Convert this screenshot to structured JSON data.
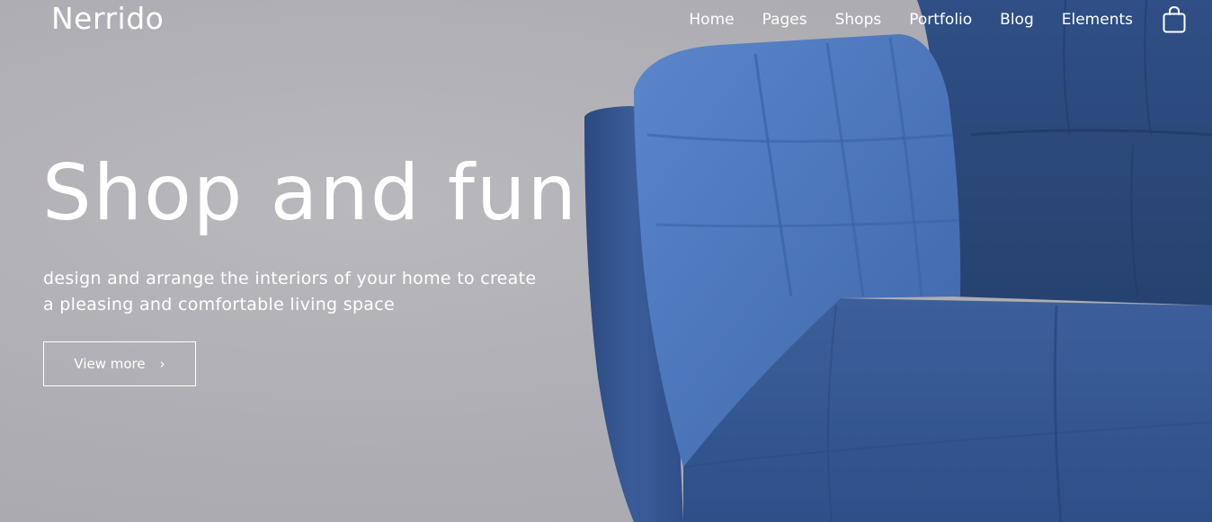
{
  "header": {
    "logo": "Nerrido",
    "nav": [
      {
        "label": "Home"
      },
      {
        "label": "Pages"
      },
      {
        "label": "Shops"
      },
      {
        "label": "Portfolio"
      },
      {
        "label": "Blog"
      },
      {
        "label": "Elements"
      }
    ],
    "cart_icon": "shopping-bag-icon"
  },
  "hero": {
    "headline": "Shop and fun",
    "subtext": "design and arrange the interiors of your home to create a pleasing and comfortable living space",
    "cta_label": "View more",
    "cta_icon": "chevron-right-icon"
  },
  "colors": {
    "background": "#b1b0b6",
    "chair_blue": "#36568f",
    "text": "#ffffff"
  }
}
